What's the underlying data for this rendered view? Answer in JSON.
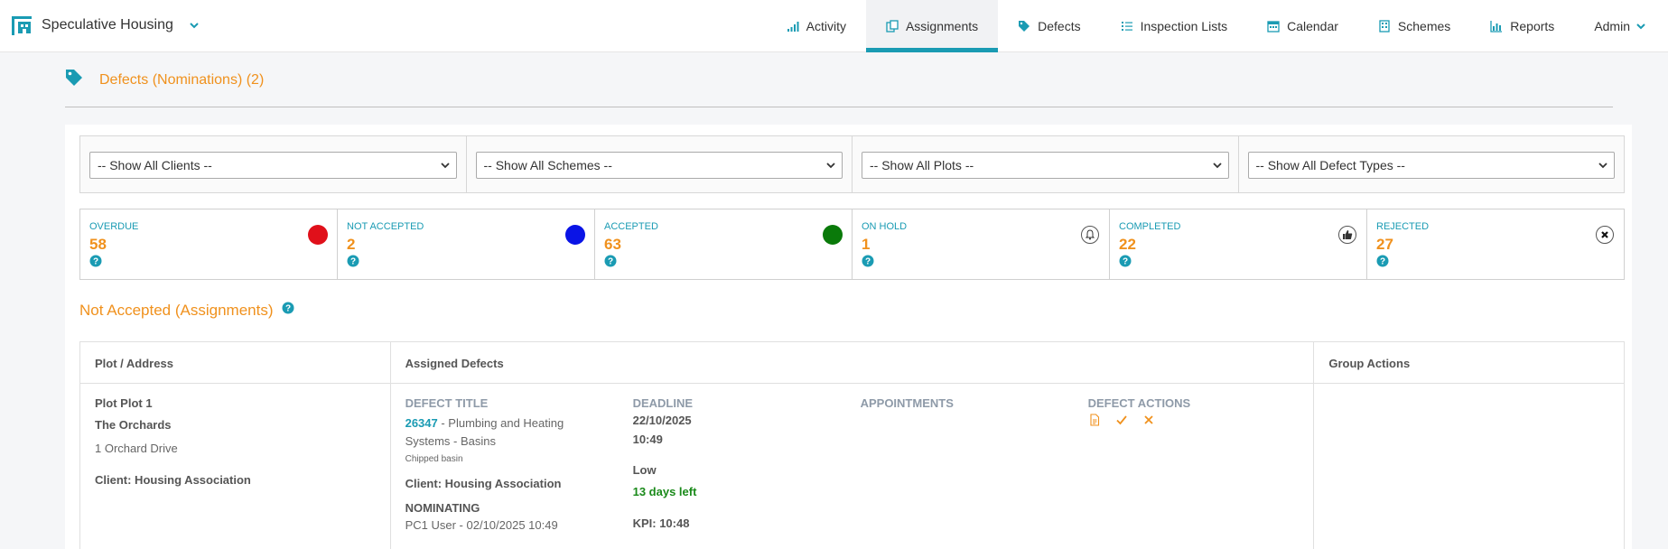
{
  "header": {
    "app_name": "Speculative Housing",
    "nav": [
      {
        "label": "Activity",
        "icon": "activity-icon"
      },
      {
        "label": "Assignments",
        "icon": "assignments-icon",
        "active": true
      },
      {
        "label": "Defects",
        "icon": "tag-icon"
      },
      {
        "label": "Inspection Lists",
        "icon": "list-icon"
      },
      {
        "label": "Calendar",
        "icon": "calendar-icon"
      },
      {
        "label": "Schemes",
        "icon": "building-icon"
      },
      {
        "label": "Reports",
        "icon": "bar-chart-icon"
      },
      {
        "label": "Admin",
        "icon": "chevron-down-icon"
      }
    ]
  },
  "page": {
    "title": "Defects (Nominations) (2)"
  },
  "filters": {
    "clients": "-- Show All Clients --",
    "schemes": "-- Show All Schemes --",
    "plots": "-- Show All Plots --",
    "defect_types": "-- Show All Defect Types --"
  },
  "stats": [
    {
      "label": "OVERDUE",
      "value": "58",
      "indicator": "#e0101a"
    },
    {
      "label": "NOT ACCEPTED",
      "value": "2",
      "indicator": "#0a14e6"
    },
    {
      "label": "ACCEPTED",
      "value": "63",
      "indicator": "#0a7a0a"
    },
    {
      "label": "ON HOLD",
      "value": "1",
      "indicator": "bell-icon"
    },
    {
      "label": "COMPLETED",
      "value": "22",
      "indicator": "thumbs-up-icon"
    },
    {
      "label": "REJECTED",
      "value": "27",
      "indicator": "x-circle-icon"
    }
  ],
  "section": {
    "title": "Not Accepted (Assignments)"
  },
  "table": {
    "headers": [
      "Plot / Address",
      "Assigned Defects",
      "Group Actions"
    ],
    "row": {
      "plot": "Plot Plot 1",
      "scheme": "The Orchards",
      "address": "1 Orchard Drive",
      "client": "Client: Housing Association",
      "defect_title_label": "DEFECT TITLE",
      "defect_id": "26347",
      "defect_title": " - Plumbing and Heating Systems - Basins",
      "defect_note": "Chipped basin",
      "defect_client": "Client: Housing Association",
      "nominating_label": "NOMINATING",
      "nominating_value": "PC1 User - 02/10/2025 10:49",
      "deadline_label": "DEADLINE",
      "deadline_date": "22/10/2025",
      "deadline_time": "10:49",
      "priority": "Low",
      "days_left": "13 days left",
      "kpi": "KPI: 10:48",
      "appointments_label": "APPOINTMENTS",
      "actions_label": "DEFECT ACTIONS"
    }
  },
  "colors": {
    "accent": "#1a9bb3",
    "orange": "#f0911d",
    "green": "#1a8a1a"
  }
}
